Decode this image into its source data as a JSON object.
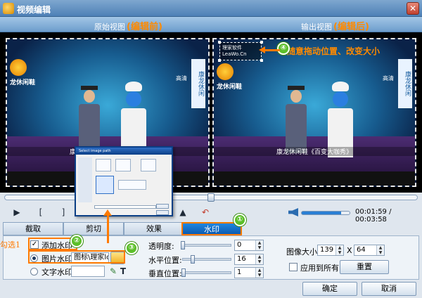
{
  "window": {
    "title": "视频编辑",
    "close_label": "✕"
  },
  "views": {
    "original_label": "原始视图",
    "original_tag": "(编辑前)",
    "output_label": "输出视图",
    "output_tag": "(编辑后)"
  },
  "video": {
    "logo_text": "龙休闲鞋",
    "side_banner": "康龙休闲",
    "corner_text": "高清",
    "caption": "康龙休闲鞋《百变大咖秀》",
    "watermark_text": "理家软件 LeaWo.Cn",
    "output_note": "可随意拖动位置、改变大小"
  },
  "playback": {
    "seek_fraction": 0.5,
    "volume_fraction": 0.82,
    "time_text": "00:01:59 / 00:03:58",
    "icons": [
      "play-icon",
      "mark-in-icon",
      "mark-out-icon",
      "snapshot-icon",
      "undo-icon"
    ]
  },
  "tabs": [
    "截取",
    "剪切",
    "效果",
    "水印"
  ],
  "watermark_panel": {
    "add_watermark_label": "添加水印",
    "add_watermark_checked": "✓",
    "image_watermark_label": "图片水印:",
    "image_path": "图标\\理家logo",
    "text_watermark_label": "文字水印:",
    "transparency_label": "透明度:",
    "transparency_value": "0",
    "transparency_fraction": 0.0,
    "h_position_label": "水平位置:",
    "h_position_value": "16",
    "h_position_fraction": 0.2,
    "v_position_label": "垂直位置:",
    "v_position_value": "1",
    "v_position_fraction": 0.02,
    "image_size_label": "图像大小:",
    "image_width": "139",
    "size_sep": "X",
    "image_height": "64",
    "apply_all_label": "应用到所有",
    "reset_label": "重置"
  },
  "footer": {
    "ok_label": "确定",
    "cancel_label": "取消"
  },
  "annotations": {
    "badge1": "①",
    "badge2": "②",
    "badge3": "③",
    "badge4": "④",
    "check_note": "勾选1"
  },
  "popup": {
    "title": "Select image path"
  },
  "colors": {
    "accent": "#ff7a00",
    "tab_active": "#0c5bb0",
    "badge": "#5cbf2a",
    "title_bar": "#4e80b6"
  }
}
